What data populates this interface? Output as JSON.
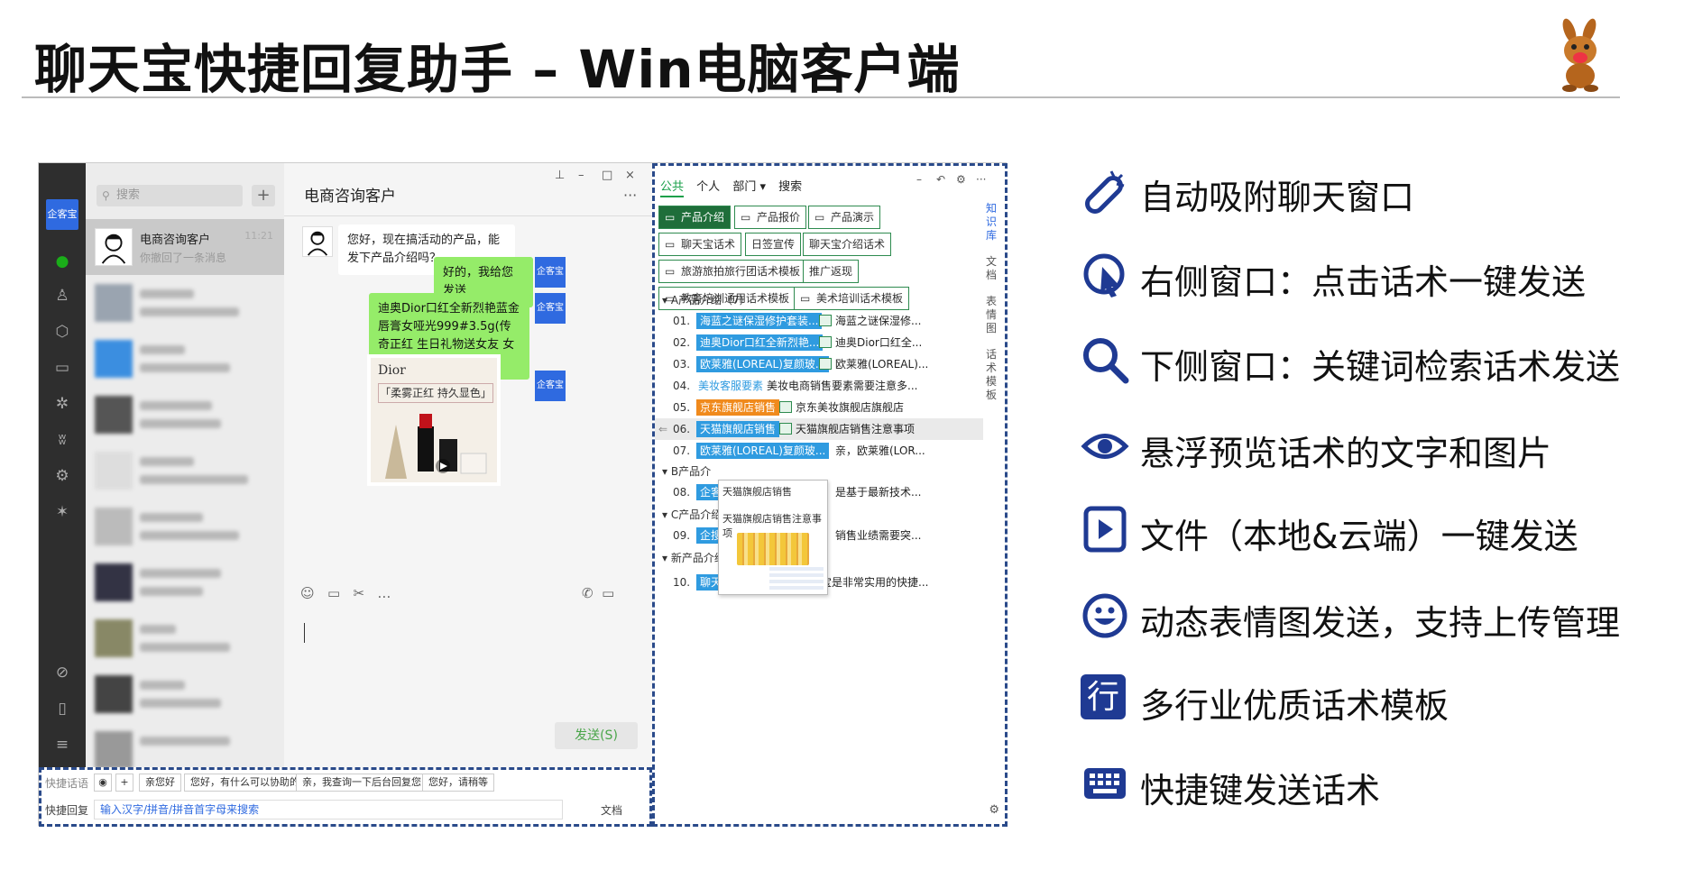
{
  "title": "聊天宝快捷回复助手 – Win电脑客户端",
  "chat": {
    "logo": "企客宝",
    "search_placeholder": "搜索",
    "add": "+",
    "contacts": [
      {
        "name": "电商咨询客户",
        "msg": "你撤回了一条消息",
        "time": "11:21"
      }
    ],
    "window_title": "电商咨询客户",
    "more": "···",
    "pin": "⊥",
    "min": "–",
    "max": "□",
    "close": "×",
    "messages": [
      {
        "side": "left",
        "text": "您好，现在搞活动的产品，能发下产品介绍吗？"
      },
      {
        "side": "right",
        "text": "好的，我给您发送"
      },
      {
        "side": "right",
        "text": "迪奥Dior口红全新烈艳蓝金唇膏女哑光999#3.5g(传奇正红 生日礼物送女友 女生 送老婆 送朋友)"
      }
    ],
    "user_avatar": "企客宝",
    "product": {
      "brand": "Dior",
      "slogan": "「柔雾正红 持久显色」"
    },
    "send": "发送(S)"
  },
  "quickbar": {
    "row1_label": "快捷话语",
    "chips": [
      "亲您好",
      "您好，有什么可以协助的",
      "亲，我查询一下后台回复您",
      "您好，请稍等"
    ],
    "row2_label": "快捷回复",
    "input_placeholder": "输入汉字/拼音/拼音首字母来搜索",
    "doc": "文档"
  },
  "panel": {
    "tabs": [
      "公共",
      "个人",
      "部门 ▾",
      "搜索"
    ],
    "side": [
      "知识库",
      "文档",
      "表情图",
      "话术模板"
    ],
    "categories": [
      "产品介绍",
      "产品报价",
      "产品演示",
      "聊天宝话术",
      "日签宣传",
      "聊天宝介绍话术",
      "旅游旅拍旅行团话术模板",
      "推广返现",
      "教育培训通用话术模板",
      "美术培训话术模板"
    ],
    "groups": [
      "A产品介绍（7）",
      "B产品介",
      "C产品介绍",
      "新产品介绍"
    ],
    "items": [
      {
        "n": "01.",
        "tag": "海蓝之谜保湿修护套装...",
        "tag_color": "#2f9be0",
        "txt": "海蓝之谜保湿修..."
      },
      {
        "n": "02.",
        "tag": "迪奥Dior口红全新烈艳...",
        "tag_color": "#2f9be0",
        "txt": "迪奥Dior口红全..."
      },
      {
        "n": "03.",
        "tag": "欧莱雅(LOREAL)复颜玻...",
        "tag_color": "#2f9be0",
        "txt": "欧莱雅(LOREAL)..."
      },
      {
        "n": "04.",
        "tag": "美妆客服要素",
        "tag_color": "",
        "txt": "美妆电商销售要素需要注意多..."
      },
      {
        "n": "05.",
        "tag": "京东旗舰店销售",
        "tag_color": "#f08a1c",
        "txt": "京东美妆旗舰店旗舰店"
      },
      {
        "n": "06.",
        "tag": "天猫旗舰店销售",
        "tag_color": "#2f9be0",
        "txt": "天猫旗舰店销售注意事项"
      },
      {
        "n": "07.",
        "tag": "欧莱雅(LOREAL)复颜玻...",
        "tag_color": "#2f9be0",
        "txt": "亲，欧莱雅(LOR..."
      },
      {
        "n": "08.",
        "tag": "企客",
        "tag_color": "#2f9be0",
        "txt": "是基于最新技术..."
      },
      {
        "n": "09.",
        "tag": "企搜",
        "tag_color": "#2f9be0",
        "txt": "销售业绩需要突..."
      },
      {
        "n": "10.",
        "tag": "聊天宝支持软件",
        "tag_color": "#2f9be0",
        "txt": "聊天宝是非常实用的快捷..."
      }
    ],
    "popup": {
      "l1": "天猫旗舰店销售",
      "l2": "天猫旗舰店销售注意事项"
    }
  },
  "features": [
    {
      "icon": "magnet-icon",
      "text": "自动吸附聊天窗口"
    },
    {
      "icon": "click-icon",
      "text": "右侧窗口：点击话术一键发送"
    },
    {
      "icon": "search-icon",
      "text": "下侧窗口：关键词检索话术发送"
    },
    {
      "icon": "eye-icon",
      "text": "悬浮预览话术的文字和图片"
    },
    {
      "icon": "file-play-icon",
      "text": "文件（本地&云端）一键发送"
    },
    {
      "icon": "smile-icon",
      "text": "动态表情图发送，支持上传管理"
    },
    {
      "icon": "industry-icon",
      "text": "多行业优质话术模板",
      "glyph": "行"
    },
    {
      "icon": "keyboard-icon",
      "text": "快捷键发送话术"
    }
  ],
  "colors": {
    "accent": "#1f3a93",
    "green": "#1f6e3a",
    "bubble": "#95ec69"
  }
}
